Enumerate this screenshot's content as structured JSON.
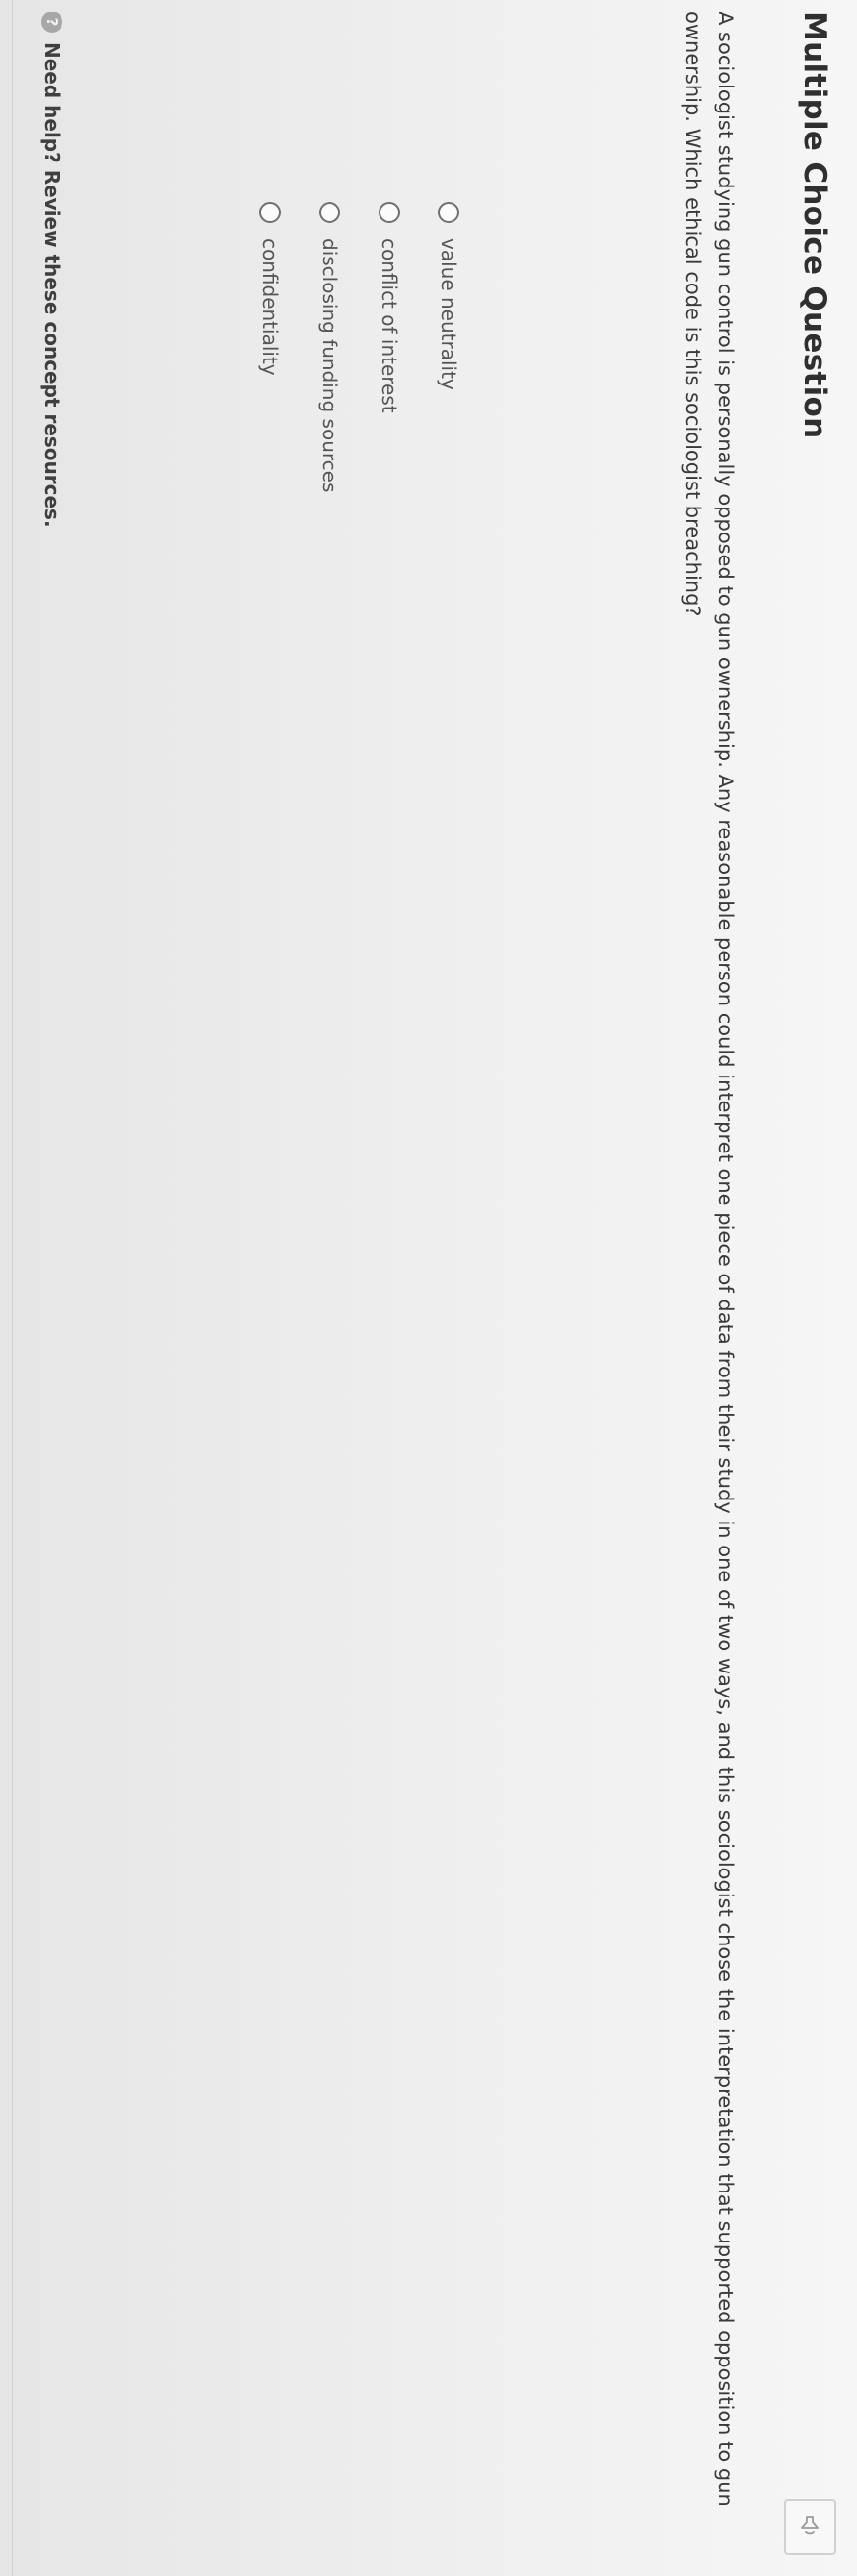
{
  "header": {
    "title": "Multiple Choice Question",
    "audio_icon": "speaker-icon"
  },
  "question": {
    "text": "A sociologist studying gun control is personally opposed to gun ownership. Any reasonable person could interpret one piece of data from their study in one of two ways, and this sociologist chose the interpretation that supported opposition to gun ownership. Which ethical code is this sociologist breaching?"
  },
  "options": [
    {
      "label": "value neutrality"
    },
    {
      "label": "conflict of interest"
    },
    {
      "label": "disclosing funding sources"
    },
    {
      "label": "confidentiality"
    }
  ],
  "help": {
    "icon": "question-icon",
    "prefix": "Need help?",
    "link": "Review these concept resources."
  },
  "colors": {
    "title": "#2f2f2f",
    "body_text": "#3a3a3a",
    "option_text": "#555555",
    "radio_border": "#6f6f6f"
  }
}
